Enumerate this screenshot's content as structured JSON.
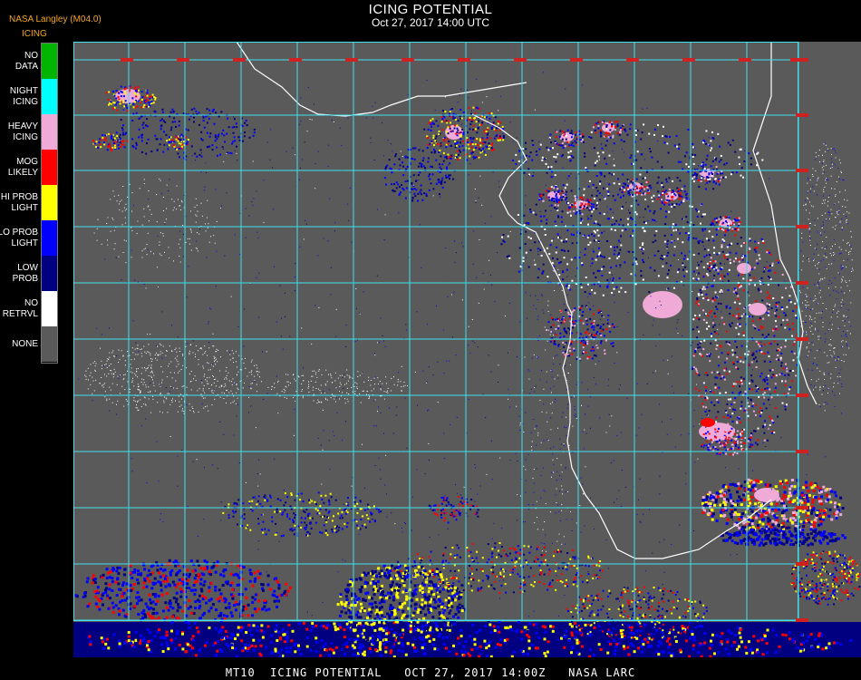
{
  "header": {
    "org": "NASA Langley (M04.0)",
    "title": "ICING POTENTIAL",
    "datetime": "Oct 27, 2017 14:00 UTC"
  },
  "legend": {
    "title": "ICING",
    "items": [
      {
        "label": "NO DATA",
        "color": "#00b400"
      },
      {
        "label": "NIGHT ICING",
        "color": "#00ffff"
      },
      {
        "label": "HEAVY ICING",
        "color": "#f0aad8"
      },
      {
        "label": "MOG LIKELY",
        "color": "#ff0000"
      },
      {
        "label": "HI PROB LIGHT",
        "color": "#ffff00"
      },
      {
        "label": "LO PROB LIGHT",
        "color": "#0000ff"
      },
      {
        "label": "LOW PROB",
        "color": "#000080"
      },
      {
        "label": "NO RETRVL",
        "color": "#ffffff"
      },
      {
        "label": "NONE",
        "color": "#5a5a5a"
      }
    ]
  },
  "map": {
    "grid_color": "#40e0f0",
    "coast_color": "#ffffff",
    "label_color": "#d02020"
  },
  "footer": {
    "text": "MT10  ICING POTENTIAL   OCT 27, 2017 14:00Z   NASA LARC"
  }
}
